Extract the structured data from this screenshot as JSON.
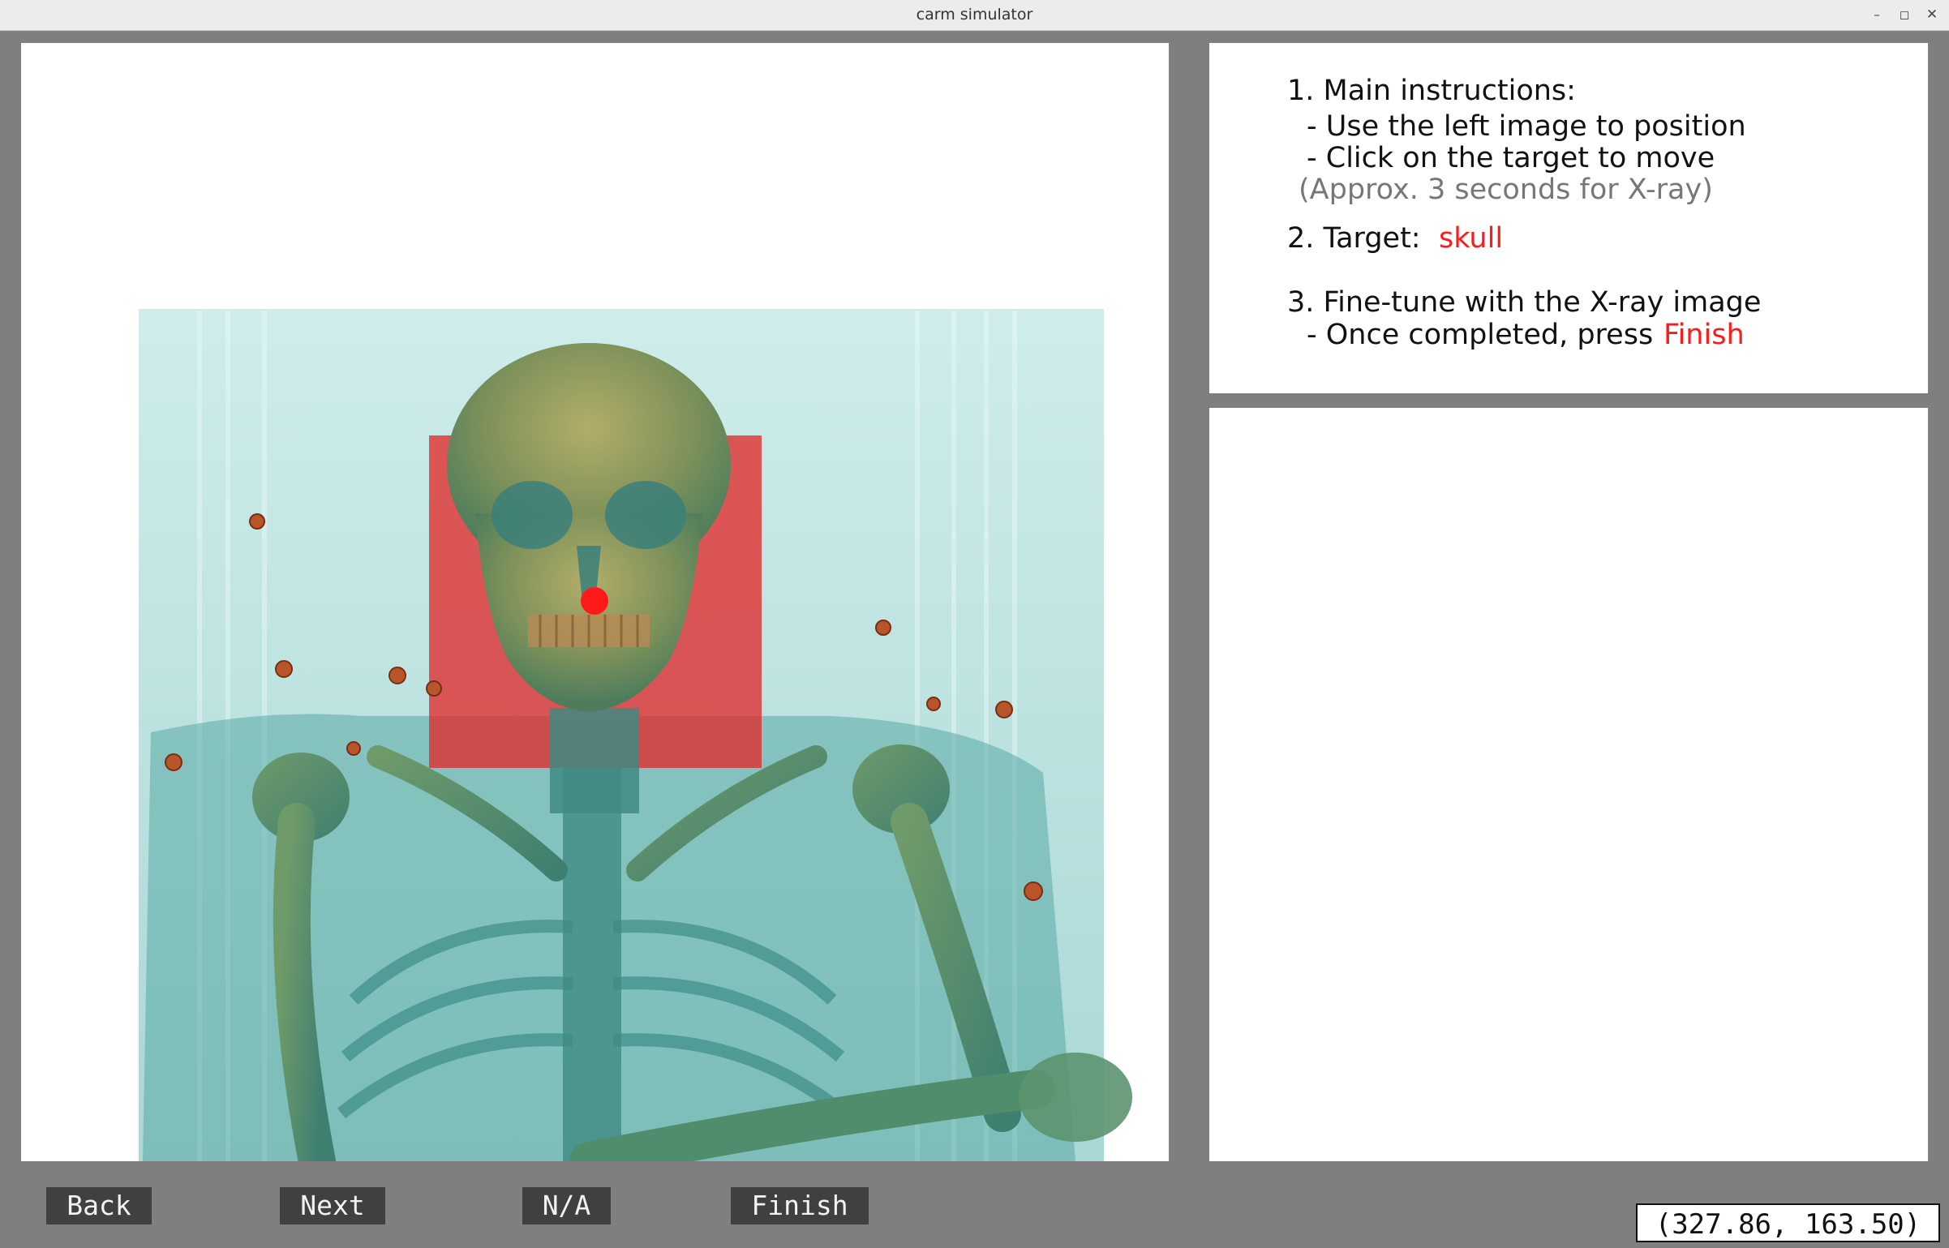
{
  "window": {
    "title": "carm simulator",
    "controls": [
      "–",
      "◻",
      "✕"
    ]
  },
  "left_view": {
    "target_marker_color": "#ff1a1a",
    "region_color": "#e03030"
  },
  "instructions": {
    "step1_title": "1. Main instructions:",
    "step1_line1": "- Use the left image to position",
    "step1_line2": "- Click on the target to move",
    "step1_note": "(Approx. 3 seconds for X-ray)",
    "step2_label": "2. Target:",
    "step2_value": "skull",
    "step3_title": "3. Fine-tune with the X-ray image",
    "step3_line1": "- Once completed, press",
    "step3_finish_word": "Finish"
  },
  "buttons": {
    "back": "Back",
    "next": "Next",
    "na": "N/A",
    "finish": "Finish"
  },
  "cursor_readout": "(327.86, 163.50)",
  "colors": {
    "background": "#7f7f7f",
    "accent_red": "#ff1a1a",
    "button_bg": "#404040"
  }
}
